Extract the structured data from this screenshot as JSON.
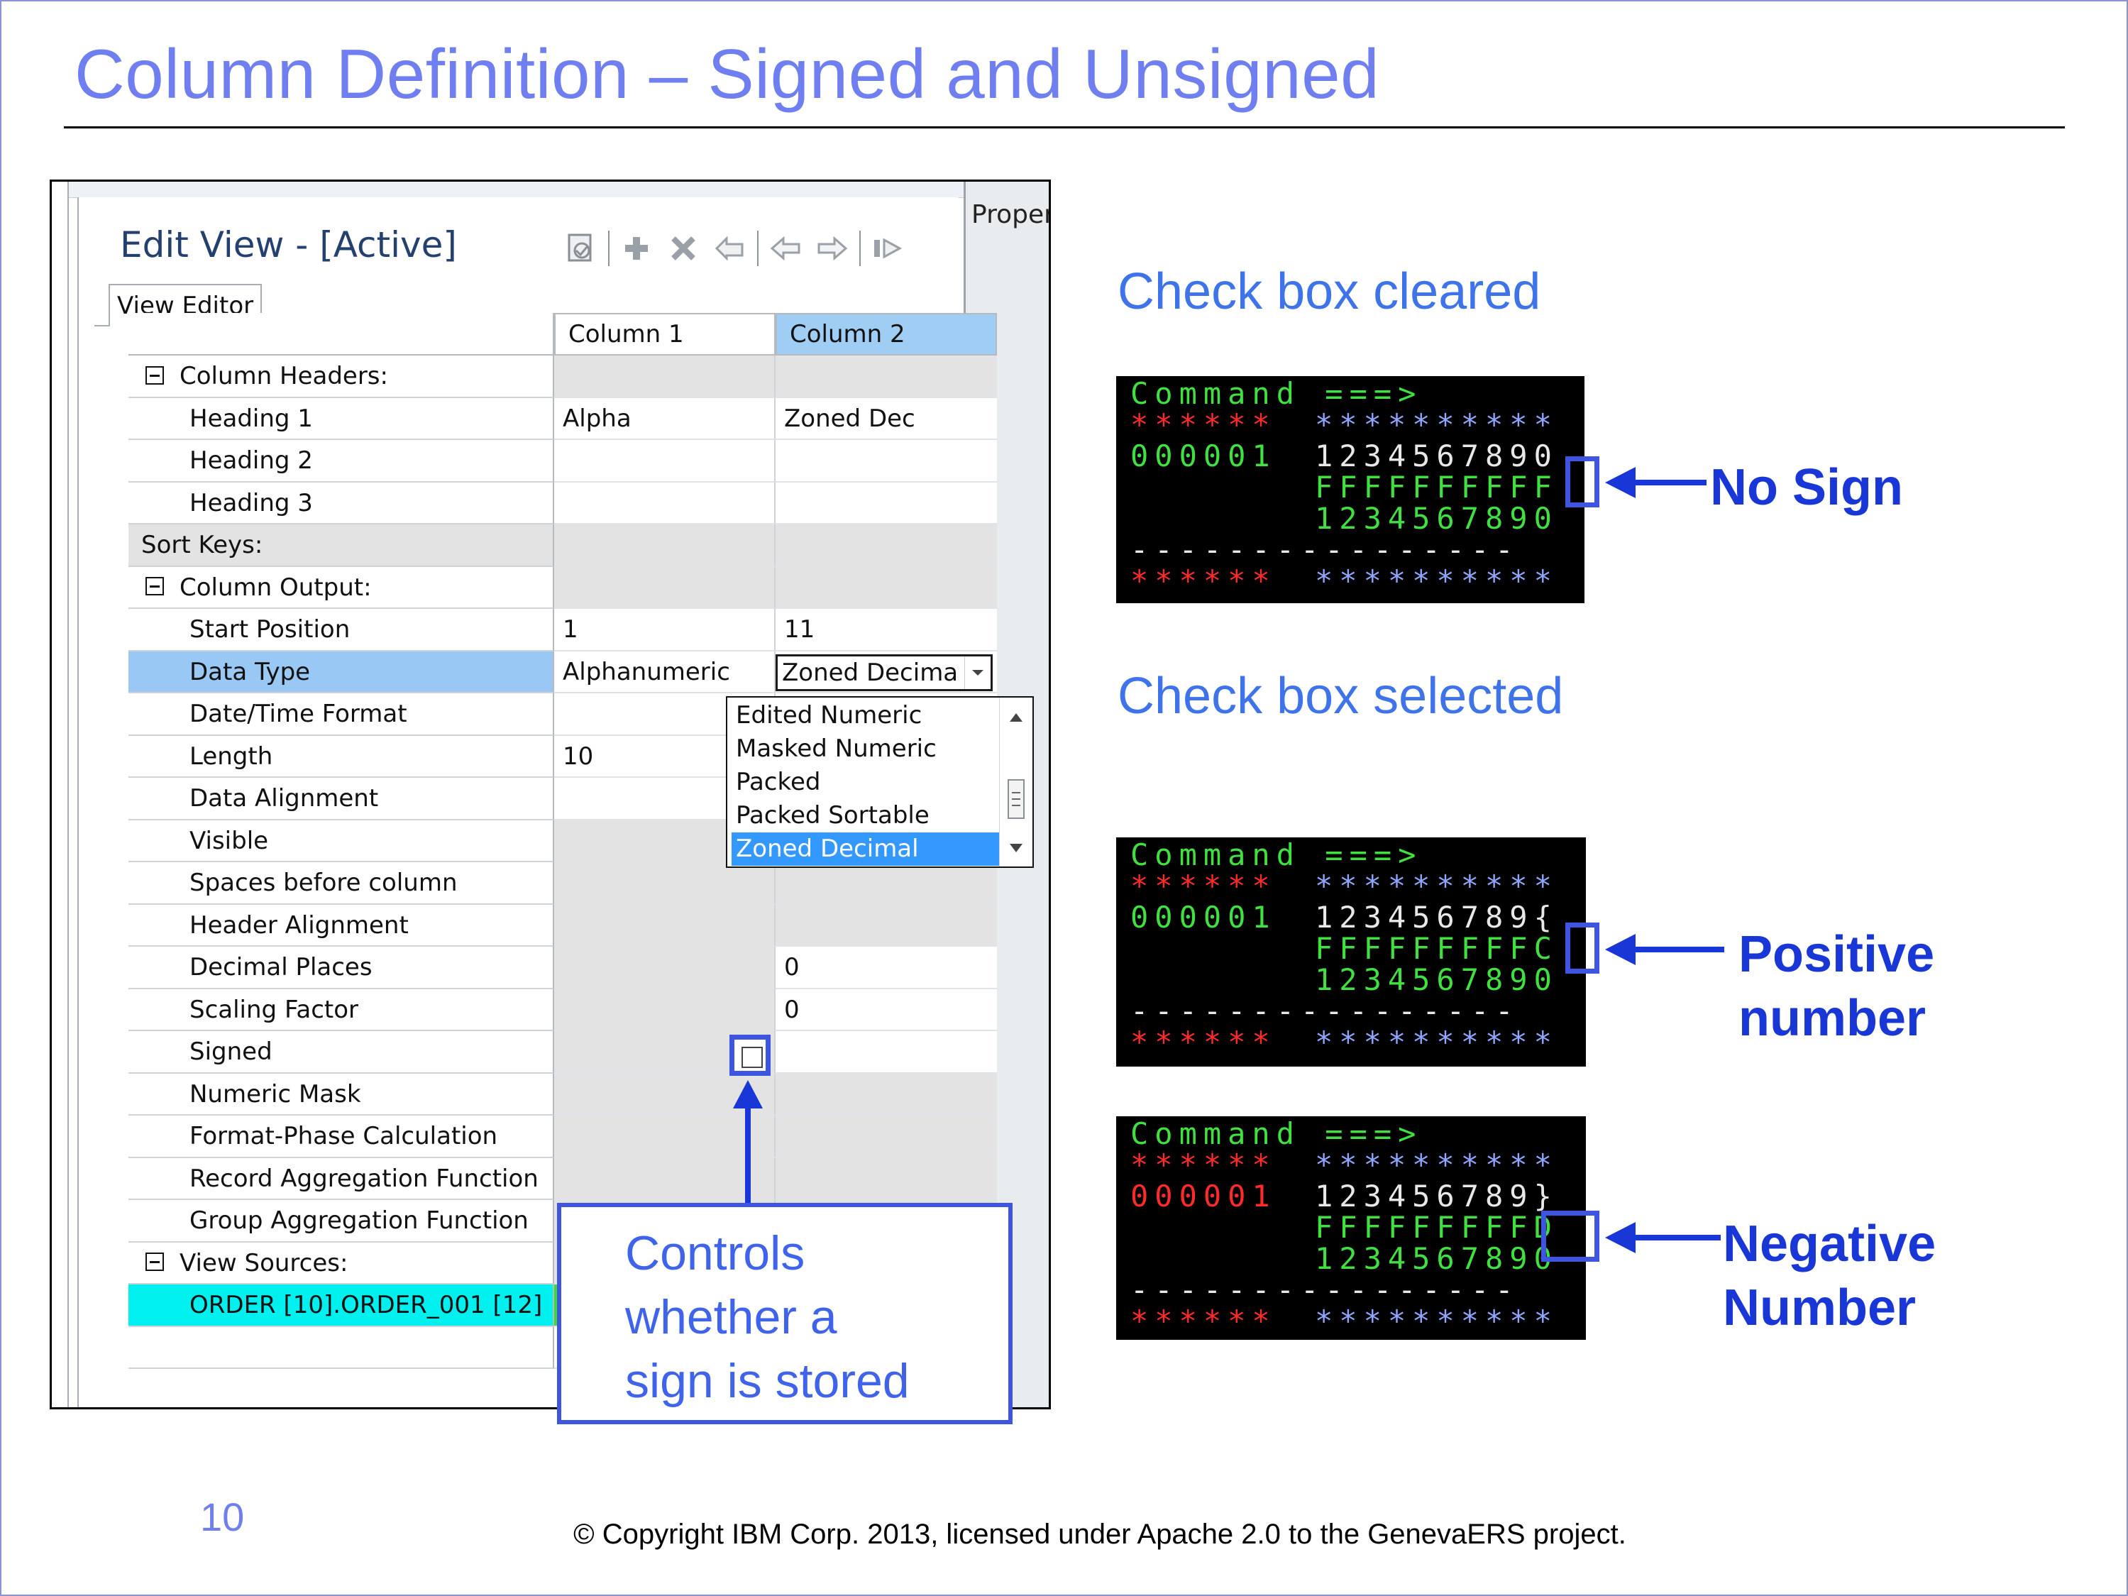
{
  "slide": {
    "title": "Column Definition – Signed and Unsigned",
    "page_number": "10",
    "copyright": "© Copyright IBM Corp. 2013, licensed under Apache 2.0 to the GenevaERS project."
  },
  "editor": {
    "side_panel_label": "Proper",
    "title": "Edit View - [Active]",
    "tab": "View Editor",
    "toolbar_icons": [
      "save-icon",
      "add-icon",
      "delete-icon",
      "undo-icon",
      "move-left-icon",
      "move-right-icon",
      "end-icon"
    ],
    "columns": [
      "Column 1",
      "Column 2"
    ],
    "rows": [
      {
        "label": "Column Headers:",
        "c1": "",
        "c2": ""
      },
      {
        "label": "Heading 1",
        "c1": "Alpha",
        "c2": "Zoned Dec"
      },
      {
        "label": "Heading 2",
        "c1": "",
        "c2": ""
      },
      {
        "label": "Heading 3",
        "c1": "",
        "c2": ""
      },
      {
        "label": "Sort Keys:",
        "c1": "",
        "c2": ""
      },
      {
        "label": "Column Output:",
        "c1": "",
        "c2": ""
      },
      {
        "label": "Start Position",
        "c1": "1",
        "c2": "11"
      },
      {
        "label": "Data Type",
        "c1": "Alphanumeric",
        "c2": "Zoned Decima"
      },
      {
        "label": "Date/Time Format",
        "c1": "",
        "c2": ""
      },
      {
        "label": "Length",
        "c1": "10",
        "c2": ""
      },
      {
        "label": "Data Alignment",
        "c1": "",
        "c2": ""
      },
      {
        "label": "Visible",
        "c1": "",
        "c2": ""
      },
      {
        "label": "Spaces before column",
        "c1": "",
        "c2": ""
      },
      {
        "label": "Header Alignment",
        "c1": "",
        "c2": ""
      },
      {
        "label": "Decimal Places",
        "c1": "",
        "c2": "0"
      },
      {
        "label": "Scaling Factor",
        "c1": "",
        "c2": "0"
      },
      {
        "label": "Signed",
        "c1": "",
        "c2": ""
      },
      {
        "label": "Numeric Mask",
        "c1": "",
        "c2": ""
      },
      {
        "label": "Format-Phase Calculation",
        "c1": "",
        "c2": ""
      },
      {
        "label": "Record Aggregation Function",
        "c1": "",
        "c2": ""
      },
      {
        "label": "Group Aggregation Function",
        "c1": "",
        "c2": ""
      },
      {
        "label": "View Sources:",
        "c1": "",
        "c2": ""
      },
      {
        "label": "ORDER [10].ORDER_001 [12]",
        "c1": "",
        "c2": ""
      }
    ],
    "data_type_options": [
      "Edited Numeric",
      "Masked Numeric",
      "Packed",
      "Packed Sortable",
      "Zoned Decimal"
    ],
    "data_type_selected": "Zoned Decimal",
    "signed_checked": false
  },
  "callout": {
    "line1": "Controls",
    "line2": "whether a",
    "line3": "sign is stored"
  },
  "right": {
    "heading_cleared": "Check box cleared",
    "heading_selected": "Check box selected",
    "terminals": [
      {
        "command": "Command ===>",
        "stars_left": "******",
        "stars_right": "**********",
        "row_id": "000001",
        "data_line": "1234567890",
        "hex_line": "FFFFFFFFFF",
        "digit_line": "1234567890",
        "dashes": "----------------",
        "label": "No Sign"
      },
      {
        "command": "Command ===>",
        "stars_left": "******",
        "stars_right": "**********",
        "row_id": "000001",
        "data_line": "123456789{",
        "hex_line": "FFFFFFFFFC",
        "digit_line": "1234567890",
        "dashes": "----------------",
        "label_line1": "Positive",
        "label_line2": "number"
      },
      {
        "command": "Command ===>",
        "stars_left": "******",
        "stars_right": "**********",
        "row_id": "000001",
        "data_line": "123456789}",
        "hex_line": "FFFFFFFFFD",
        "digit_line": "1234567890",
        "dashes": "----------------",
        "label_line1": "Negative",
        "label_line2": "Number"
      }
    ]
  },
  "colors": {
    "title": "#6f7ff0",
    "accent_blue": "#3d55e0",
    "heading_blue": "#3f73ea",
    "label_blue": "#1937d6",
    "selection_blue": "#98c8f3",
    "cyan_row": "#00f0f0"
  }
}
